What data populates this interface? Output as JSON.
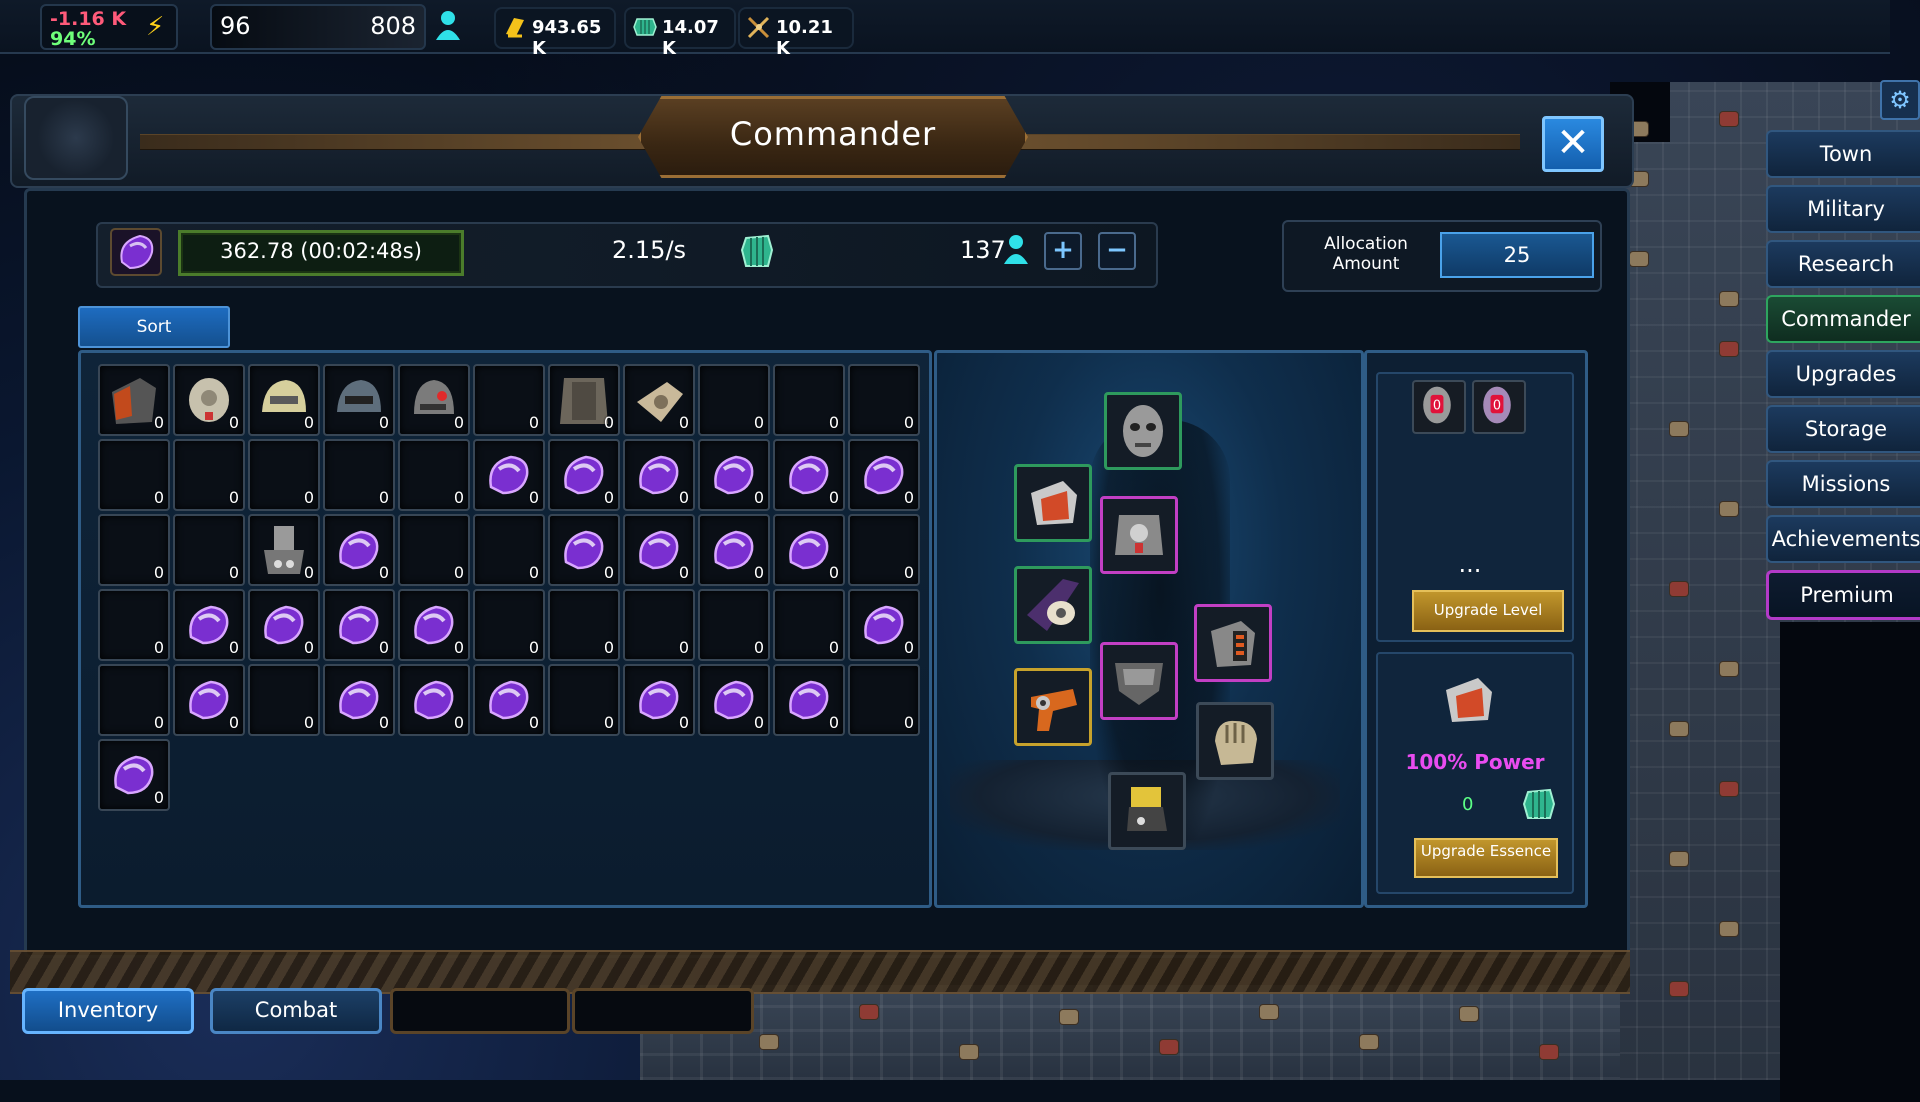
{
  "topbar": {
    "power_delta": "-1.16 K",
    "power_percent": "94%",
    "pop_current": "96",
    "pop_max": "808",
    "resources": [
      {
        "name": "gold-icon",
        "value": "943.65 K",
        "color": "#f4c21a"
      },
      {
        "name": "crystal-icon",
        "value": "14.07 K",
        "color": "#3fc9a0"
      },
      {
        "name": "weapons-icon",
        "value": "10.21 K",
        "color": "#e0b35a"
      }
    ]
  },
  "window": {
    "title": "Commander",
    "close_icon": "close-icon"
  },
  "stats": {
    "essence": "362.78 (00:02:48s)",
    "rate": "2.15/s",
    "assigned": "137",
    "plus_label": "+",
    "minus_label": "−",
    "allocation_label": "Allocation Amount",
    "allocation_value": "25"
  },
  "sort_label": "Sort",
  "inventory": {
    "rows": [
      [
        "armor",
        "mask",
        "helmet-gold",
        "helmet-steel",
        "helmet-red",
        "empty",
        "chest",
        "gauntlet",
        "empty",
        "empty",
        "empty"
      ],
      [
        "empty",
        "empty",
        "empty",
        "empty",
        "empty",
        "gem",
        "gem",
        "gem",
        "gem",
        "gem",
        "gem"
      ],
      [
        "empty",
        "empty",
        "cannon",
        "gem",
        "empty",
        "empty",
        "gem",
        "gem",
        "gem",
        "gem",
        "empty"
      ],
      [
        "empty",
        "gem",
        "gem",
        "gem",
        "gem",
        "empty",
        "empty",
        "empty",
        "empty",
        "empty",
        "gem"
      ],
      [
        "empty",
        "gem",
        "empty",
        "gem",
        "gem",
        "gem",
        "empty",
        "gem",
        "gem",
        "gem",
        "empty"
      ],
      [
        "gem"
      ]
    ],
    "quantity": "0"
  },
  "equipment": [
    {
      "slot": "head",
      "icon": "mask"
    },
    {
      "slot": "shoulder",
      "icon": "shoulder"
    },
    {
      "slot": "chest",
      "icon": "chest"
    },
    {
      "slot": "arm",
      "icon": "bracer"
    },
    {
      "slot": "module",
      "icon": "module"
    },
    {
      "slot": "belt",
      "icon": "belt"
    },
    {
      "slot": "weapon",
      "icon": "blaster"
    },
    {
      "slot": "gloves",
      "icon": "gloves"
    },
    {
      "slot": "boots",
      "icon": "boots"
    }
  ],
  "side": {
    "dots": "...",
    "upgrade_level_label": "Upgrade Level",
    "power_text": "100% Power",
    "essence_cost": "0",
    "upgrade_essence_label": "Upgrade Essence"
  },
  "bottom_tabs": [
    {
      "label": "Inventory",
      "active": true
    },
    {
      "label": "Combat",
      "active": false
    },
    {
      "label": "",
      "active": false
    },
    {
      "label": "",
      "active": false
    }
  ],
  "nav": [
    "Town",
    "Military",
    "Research",
    "Commander",
    "Upgrades",
    "Storage",
    "Missions",
    "Achievements",
    "Premium"
  ],
  "nav_active": "Commander"
}
